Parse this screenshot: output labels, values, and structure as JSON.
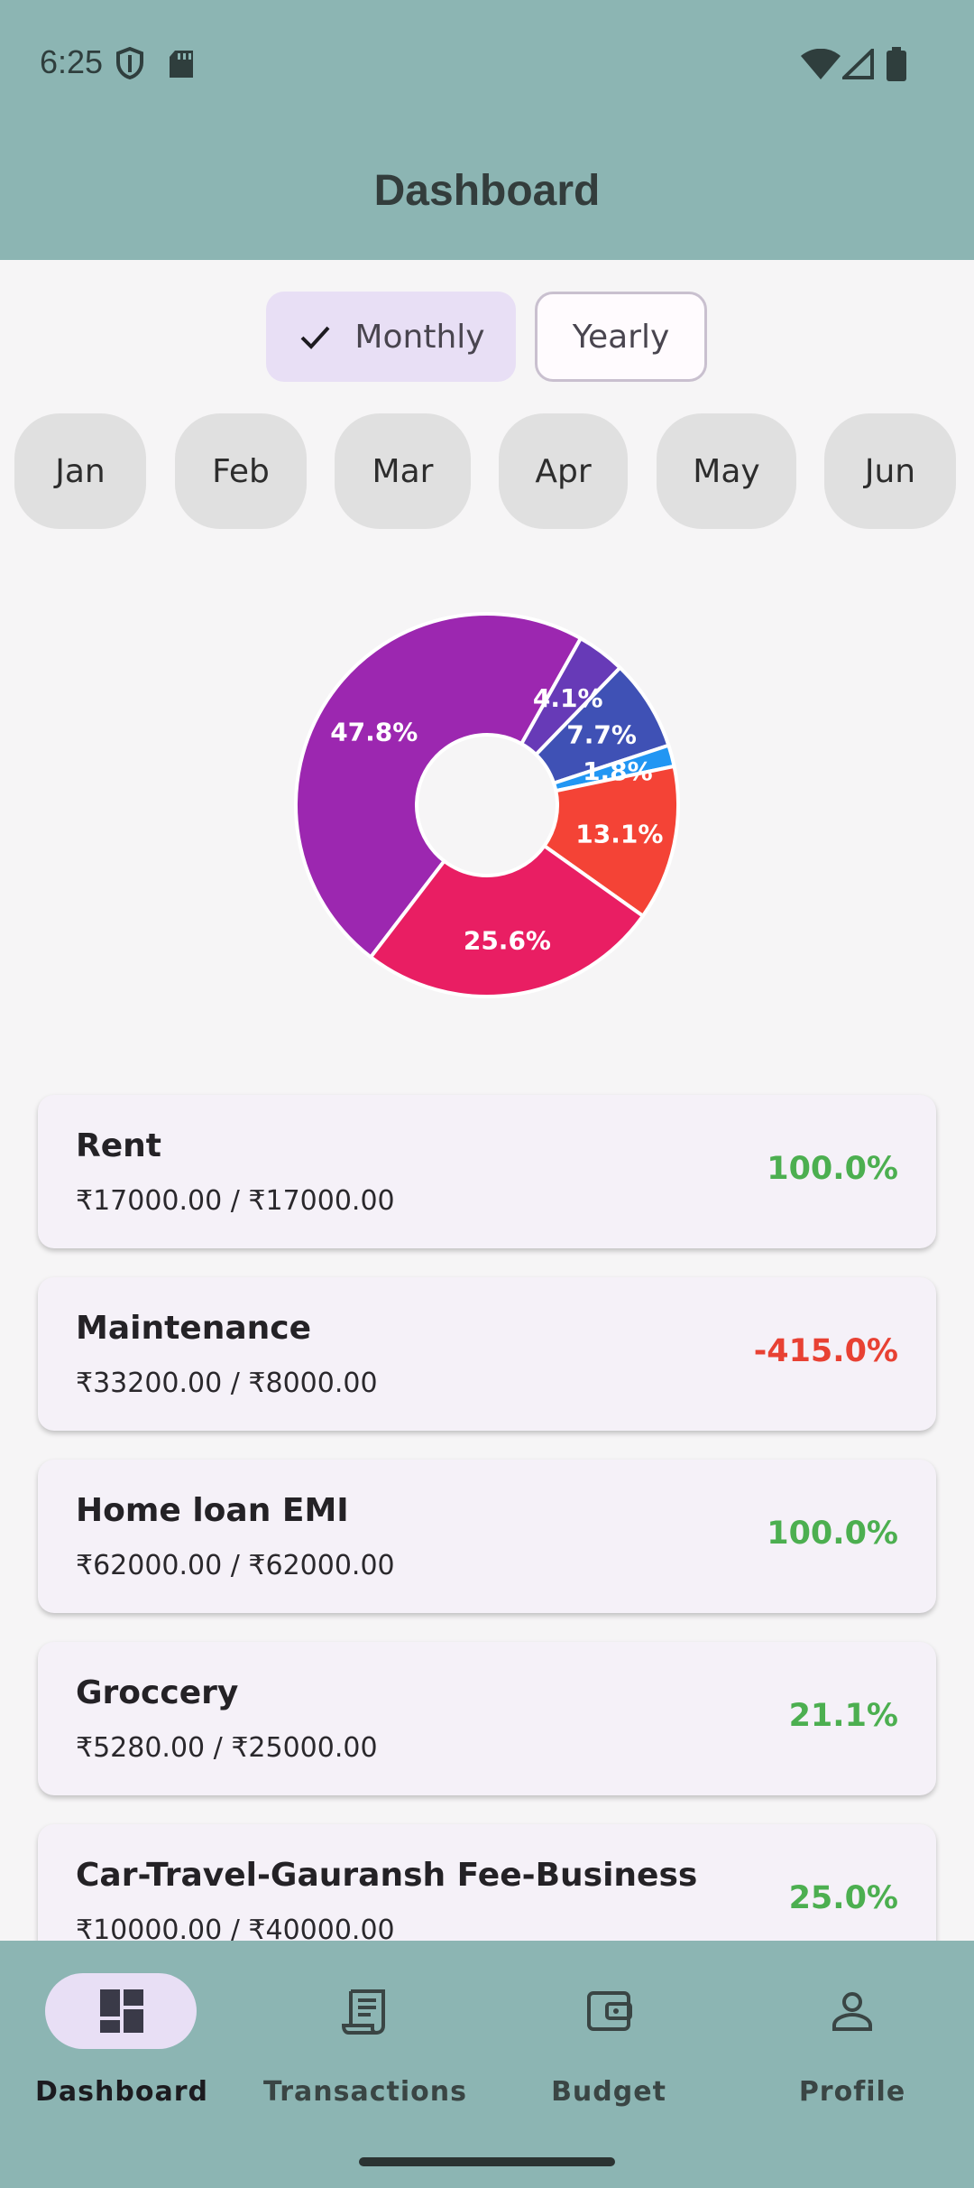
{
  "status_bar": {
    "time": "6:25"
  },
  "app_bar": {
    "title": "Dashboard"
  },
  "period_toggle": {
    "monthly_label": "Monthly",
    "yearly_label": "Yearly",
    "selected": "Monthly"
  },
  "months": [
    "Jan",
    "Feb",
    "Mar",
    "Apr",
    "May",
    "Jun"
  ],
  "chart_data": {
    "type": "pie",
    "slices": [
      {
        "label": "47.8%",
        "value": 47.8,
        "color": "#9c27b0"
      },
      {
        "label": "4.1%",
        "value": 4.1,
        "color": "#673ab7"
      },
      {
        "label": "7.7%",
        "value": 7.7,
        "color": "#3f51b5"
      },
      {
        "label": "1.8%",
        "value": 1.8,
        "color": "#2196f3"
      },
      {
        "label": "13.1%",
        "value": 13.1,
        "color": "#f44336"
      },
      {
        "label": "25.6%",
        "value": 25.6,
        "color": "#e91e63"
      }
    ]
  },
  "budgets": [
    {
      "name": "Rent",
      "amount": "₹17000.00 / ₹17000.00",
      "percent": "100.0%",
      "status": "positive"
    },
    {
      "name": "Maintenance",
      "amount": "₹33200.00 / ₹8000.00",
      "percent": "-415.0%",
      "status": "negative"
    },
    {
      "name": "Home loan EMI",
      "amount": "₹62000.00 / ₹62000.00",
      "percent": "100.0%",
      "status": "positive"
    },
    {
      "name": "Groccery",
      "amount": "₹5280.00 / ₹25000.00",
      "percent": "21.1%",
      "status": "positive"
    },
    {
      "name": "Car-Travel-Gauransh Fee-Business",
      "amount": "₹10000.00 / ₹40000.00",
      "percent": "25.0%",
      "status": "positive"
    }
  ],
  "bottom_nav": [
    {
      "label": "Dashboard",
      "icon": "dashboard-icon",
      "active": true
    },
    {
      "label": "Transactions",
      "icon": "receipt-icon",
      "active": false
    },
    {
      "label": "Budget",
      "icon": "wallet-icon",
      "active": false
    },
    {
      "label": "Profile",
      "icon": "person-icon",
      "active": false
    }
  ]
}
